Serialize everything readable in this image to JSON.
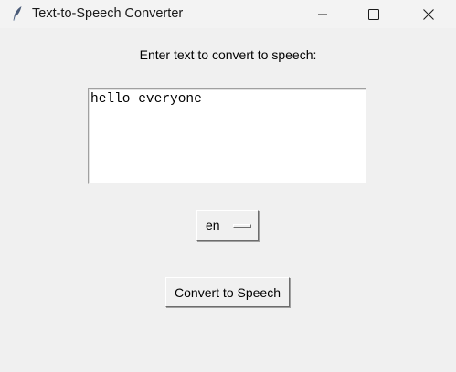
{
  "window": {
    "title": "Text-to-Speech Converter",
    "app_icon": "feather-icon",
    "controls": [
      "minimize-icon",
      "maximize-icon",
      "close-icon"
    ]
  },
  "main": {
    "prompt_label": "Enter text to convert to speech:",
    "text_input_value": "hello everyone",
    "language_menu": {
      "selected": "en"
    },
    "convert_button_label": "Convert to Speech"
  },
  "colors": {
    "window_background": "#f0f0f0",
    "titlebar_background": "#f3f3f3",
    "textbox_background": "#ffffff"
  }
}
